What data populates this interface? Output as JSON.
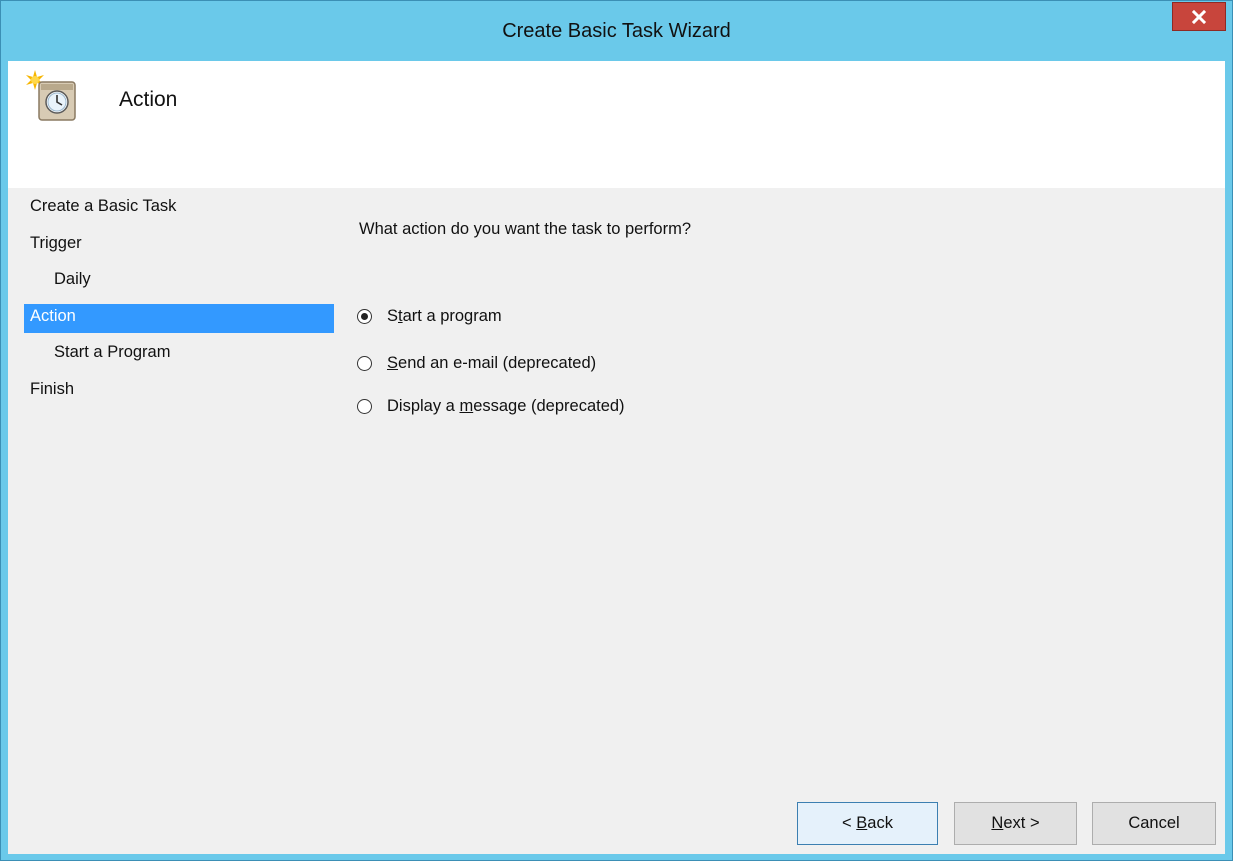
{
  "window": {
    "title": "Create Basic Task Wizard"
  },
  "header": {
    "title": "Action",
    "icon": "task-scheduler-clock-icon"
  },
  "nav": {
    "items": [
      {
        "label": "Create a Basic Task",
        "indent": false,
        "selected": false
      },
      {
        "label": "Trigger",
        "indent": false,
        "selected": false
      },
      {
        "label": "Daily",
        "indent": true,
        "selected": false
      },
      {
        "label": "Action",
        "indent": false,
        "selected": true
      },
      {
        "label": "Start a Program",
        "indent": true,
        "selected": false
      },
      {
        "label": "Finish",
        "indent": false,
        "selected": false
      }
    ]
  },
  "main": {
    "question": "What action do you want the task to perform?",
    "options": [
      {
        "pre": "S",
        "ul": "t",
        "post": "art a program",
        "checked": true
      },
      {
        "pre": "",
        "ul": "S",
        "post": "end an e-mail (deprecated)",
        "checked": false
      },
      {
        "pre": "Display a ",
        "ul": "m",
        "post": "essage (deprecated)",
        "checked": false
      }
    ]
  },
  "buttons": {
    "back": {
      "pre": "< ",
      "ul": "B",
      "post": "ack"
    },
    "next": {
      "pre": "",
      "ul": "N",
      "post": "ext >"
    },
    "cancel": {
      "label": "Cancel"
    }
  },
  "colors": {
    "titlebar": "#6ac9ea",
    "close": "#c8453c",
    "selection": "#3399ff"
  }
}
